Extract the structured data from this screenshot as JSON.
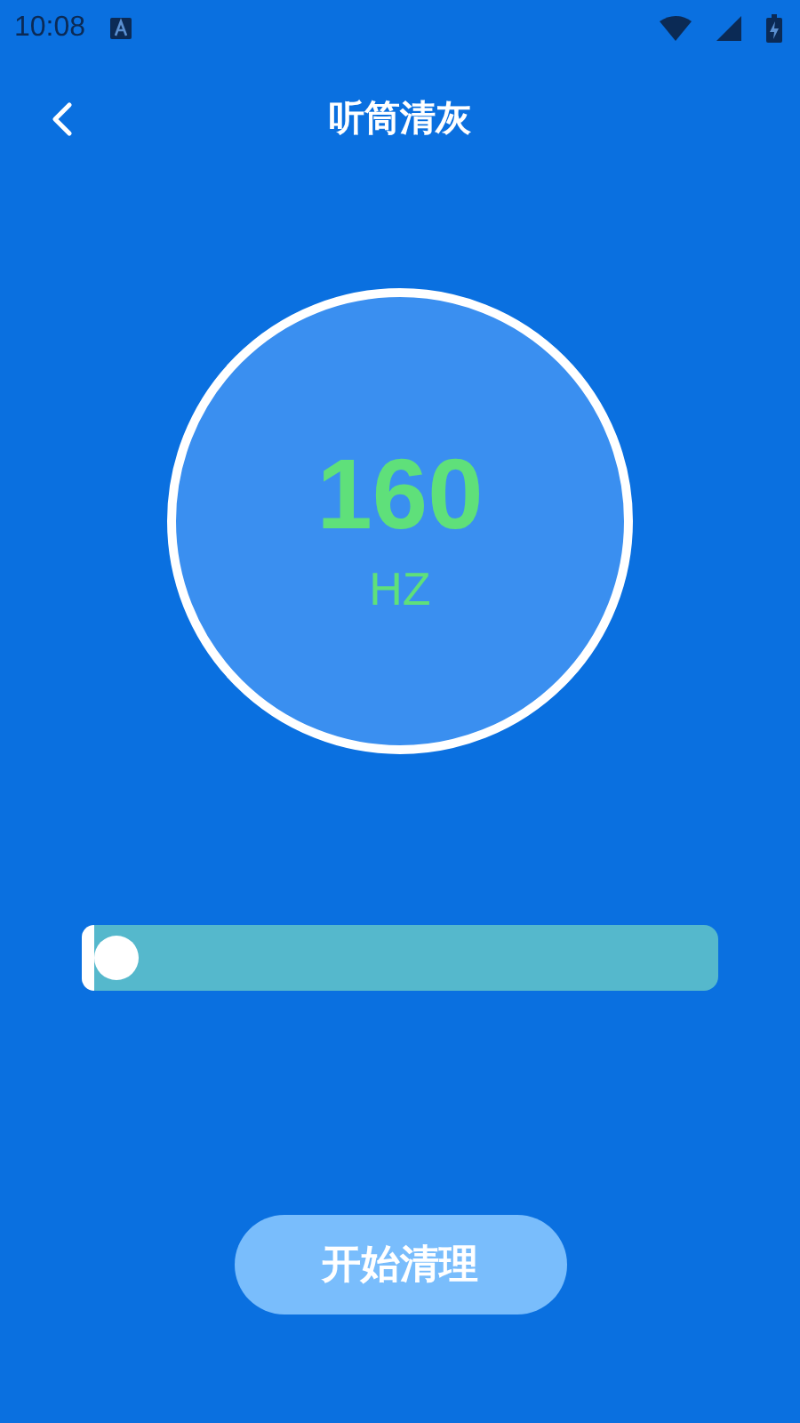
{
  "status_bar": {
    "time": "10:08"
  },
  "header": {
    "title": "听筒清灰"
  },
  "dial": {
    "value": "160",
    "unit": "HZ"
  },
  "slider": {
    "level": 0.02
  },
  "start_button": {
    "label": "开始清理"
  }
}
